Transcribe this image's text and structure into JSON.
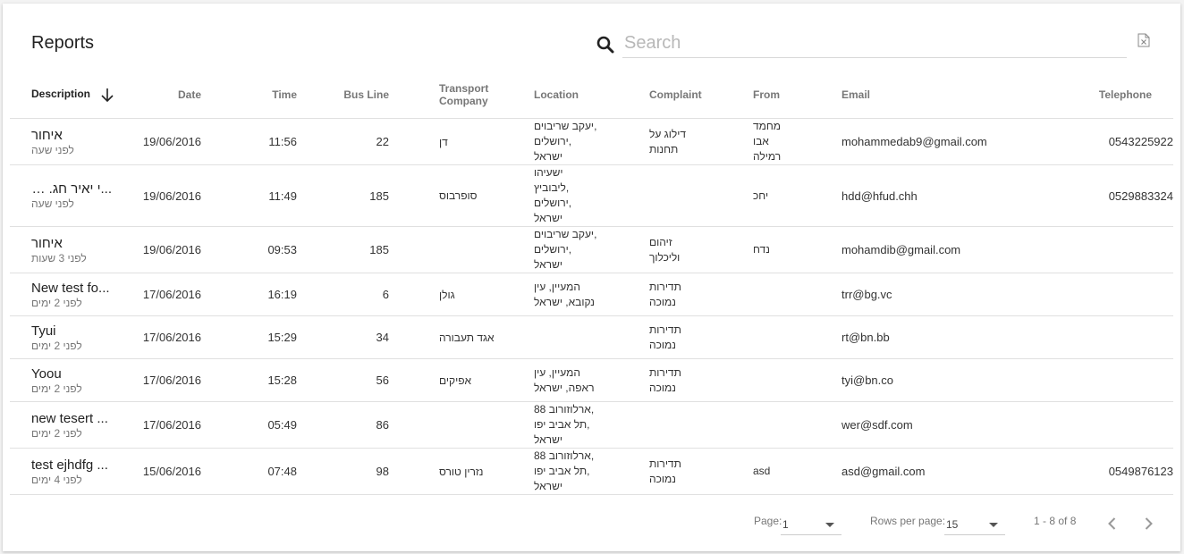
{
  "header": {
    "title": "Reports",
    "search_placeholder": "Search",
    "search_value": ""
  },
  "columns": {
    "description": "Description",
    "date": "Date",
    "time": "Time",
    "bus_line": "Bus Line",
    "transport_company": "Transport Company",
    "location": "Location",
    "complaint": "Complaint",
    "from": "From",
    "email": "Email",
    "telephone": "Telephone"
  },
  "rows": [
    {
      "description": "איחור",
      "ago": "לפני שעה",
      "date": "19/06/2016",
      "time": "11:56",
      "bus_line": "22",
      "company": "דן",
      "location": "יעקב שריבוים,\nירושלים,\nישראל",
      "complaint": "דילוג על\nתחנות",
      "from": "מחמד\nאבו\nרמילה",
      "email": "mohammedab9@gmail.com",
      "telephone": "0543225922"
    },
    {
      "description": "...י יאיר חג. עבד",
      "ago": "לפני שעה",
      "date": "19/06/2016",
      "time": "11:49",
      "bus_line": "185",
      "company": "סופרבוס",
      "location": "ישעיהו\nליבוביץ,\nירושלים,\nישראל",
      "complaint": "",
      "from": "יחכ",
      "email": "hdd@hfud.chh",
      "telephone": "0529883324"
    },
    {
      "description": "איחור",
      "ago": "לפני 3 שעות",
      "date": "19/06/2016",
      "time": "09:53",
      "bus_line": "185",
      "company": "",
      "location": "יעקב שריבוים,\nירושלים,\nישראל",
      "complaint": "זיהום\nוליכלוך",
      "from": "נדח",
      "email": "mohamdib@gmail.com",
      "telephone": ""
    },
    {
      "description": "New test fo...",
      "ago": "לפני 2 ימים",
      "date": "17/06/2016",
      "time": "16:19",
      "bus_line": "6",
      "company": "גולן",
      "location": "המעיין, עין\nנקובא, ישראל",
      "complaint": "תדירות\nנמוכה",
      "from": "",
      "email": "trr@bg.vc",
      "telephone": ""
    },
    {
      "description": "Tyui",
      "ago": "לפני 2 ימים",
      "date": "17/06/2016",
      "time": "15:29",
      "bus_line": "34",
      "company": "אגד תעבורה",
      "location": "",
      "complaint": "תדירות\nנמוכה",
      "from": "",
      "email": "rt@bn.bb",
      "telephone": ""
    },
    {
      "description": "Yoou",
      "ago": "לפני 2 ימים",
      "date": "17/06/2016",
      "time": "15:28",
      "bus_line": "56",
      "company": "אפיקים",
      "location": "המעיין, עין\nראפה, ישראל",
      "complaint": "תדירות\nנמוכה",
      "from": "",
      "email": "tyi@bn.co",
      "telephone": ""
    },
    {
      "description": "new tesert ...",
      "ago": "לפני 2 ימים",
      "date": "17/06/2016",
      "time": "05:49",
      "bus_line": "86",
      "company": "",
      "location": "ארלוזורוב 88,\nתל אביב יפו,\nישראל",
      "complaint": "",
      "from": "",
      "email": "wer@sdf.com",
      "telephone": ""
    },
    {
      "description": "test ejhdfg ...",
      "ago": "לפני 4 ימים",
      "date": "15/06/2016",
      "time": "07:48",
      "bus_line": "98",
      "company": "נזרין טורס",
      "location": "ארלוזורוב 88,\nתל אביב יפו,\nישראל",
      "complaint": "תדירות\nנמוכה",
      "from": "asd",
      "email": "asd@gmail.com",
      "telephone": "0549876123"
    }
  ],
  "footer": {
    "page_label": "Page:",
    "page_value": "1",
    "rows_label": "Rows per page:",
    "rows_value": "15",
    "range_text": "1 - 8 of 8"
  }
}
